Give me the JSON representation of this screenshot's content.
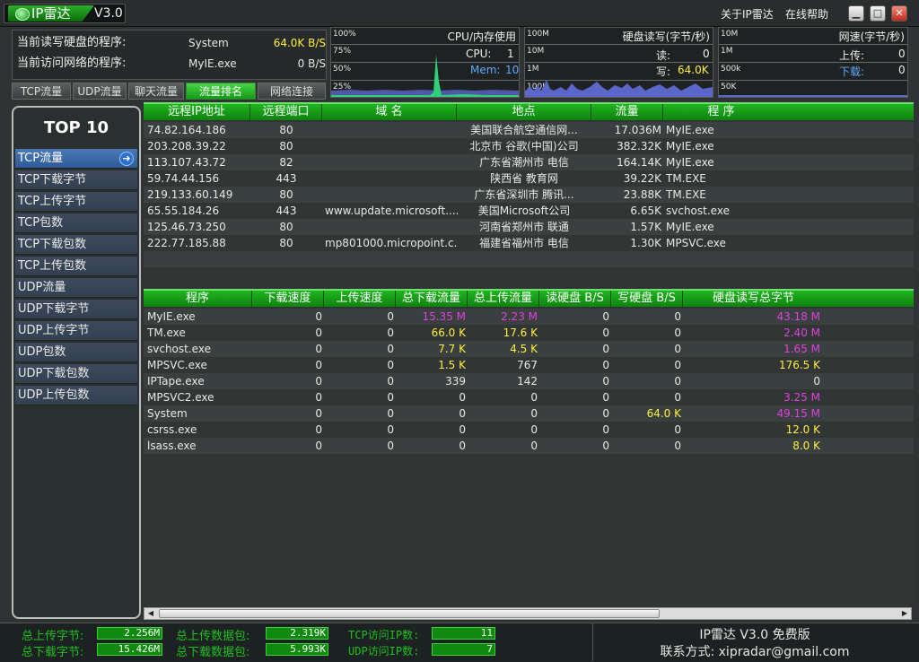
{
  "title": {
    "app_name": "IP雷达",
    "version": "V3.0",
    "menu_about": "关于IP雷达",
    "menu_help": "在线帮助"
  },
  "info": {
    "disk_label": "当前读写硬盘的程序:",
    "disk_process": "System",
    "disk_value": "64.0K B/S",
    "net_label": "当前访问网络的程序:",
    "net_process": "MyIE.exe",
    "net_value": "0 B/S"
  },
  "tabs": [
    "TCP流量",
    "UDP流量",
    "聊天流量",
    "流量排名",
    "网络连接"
  ],
  "active_tab_index": 3,
  "graphs": {
    "cpu": {
      "title": "CPU/内存使用",
      "ticks": [
        "100%",
        "75%",
        "50%",
        "25%"
      ],
      "cpu_label": "CPU:",
      "cpu_value": "1",
      "mem_label": "Mem:",
      "mem_value": "10"
    },
    "disk": {
      "title": "硬盘读写(字节/秒)",
      "ticks": [
        "100M",
        "10M",
        "1M",
        "100K"
      ],
      "read_label": "读:",
      "read_value": "0",
      "write_label": "写:",
      "write_value": "64.0K"
    },
    "net": {
      "title": "网速(字节/秒)",
      "ticks": [
        "10M",
        "1M",
        "500k",
        "50K"
      ],
      "up_label": "上传:",
      "up_value": "0",
      "down_label": "下载:",
      "down_value": "0"
    }
  },
  "left_panel": {
    "title": "TOP 10",
    "active_index": 0,
    "items": [
      "TCP流量",
      "TCP下载字节",
      "TCP上传字节",
      "TCP包数",
      "TCP下载包数",
      "TCP上传包数",
      "UDP流量",
      "UDP下载字节",
      "UDP上传字节",
      "UDP包数",
      "UDP下载包数",
      "UDP上传包数"
    ]
  },
  "connections": {
    "headers": [
      "远程IP地址",
      "远程端口",
      "域  名",
      "地点",
      "流量",
      "程  序"
    ],
    "rows": [
      [
        "74.82.164.186",
        "80",
        "",
        "美国联合航空通信网...",
        "17.036M",
        "MyIE.exe"
      ],
      [
        "203.208.39.22",
        "80",
        "",
        "北京市 谷歌(中国)公司",
        "382.32K",
        "MyIE.exe"
      ],
      [
        "113.107.43.72",
        "82",
        "",
        "广东省潮州市 电信",
        "164.14K",
        "MyIE.exe"
      ],
      [
        "59.74.44.156",
        "443",
        "",
        "陕西省 教育网",
        "39.22K",
        "TM.EXE"
      ],
      [
        "219.133.60.149",
        "80",
        "",
        "广东省深圳市 腾讯...",
        "23.88K",
        "TM.EXE"
      ],
      [
        "65.55.184.26",
        "443",
        "www.update.microsoft....",
        "美国Microsoft公司",
        "6.65K",
        "svchost.exe"
      ],
      [
        "125.46.73.250",
        "80",
        "",
        "河南省郑州市 联通",
        "1.57K",
        "MyIE.exe"
      ],
      [
        "222.77.185.88",
        "80",
        "mp801000.micropoint.c...",
        "福建省福州市 电信",
        "1.30K",
        "MPSVC.exe"
      ]
    ]
  },
  "processes": {
    "headers": [
      "程序",
      "下载速度",
      "上传速度",
      "总下载流量",
      "总上传流量",
      "读硬盘 B/S",
      "写硬盘 B/S",
      "硬盘读写总字节"
    ],
    "rows": [
      [
        "MyIE.exe",
        "0",
        "0",
        "15.35 M",
        "2.23 M",
        "0",
        "0",
        "43.18 M"
      ],
      [
        "TM.exe",
        "0",
        "0",
        "66.0 K",
        "17.6 K",
        "0",
        "0",
        "2.40 M"
      ],
      [
        "svchost.exe",
        "0",
        "0",
        "7.7 K",
        "4.5 K",
        "0",
        "0",
        "1.65 M"
      ],
      [
        "MPSVC.exe",
        "0",
        "0",
        "1.5 K",
        "767",
        "0",
        "0",
        "176.5 K"
      ],
      [
        "IPTape.exe",
        "0",
        "0",
        "339",
        "142",
        "0",
        "0",
        "0"
      ],
      [
        "MPSVC2.exe",
        "0",
        "0",
        "0",
        "0",
        "0",
        "0",
        "3.25 M"
      ],
      [
        "System",
        "0",
        "0",
        "0",
        "0",
        "0",
        "64.0 K",
        "49.15 M"
      ],
      [
        "csrss.exe",
        "0",
        "0",
        "0",
        "0",
        "0",
        "0",
        "12.0 K"
      ],
      [
        "lsass.exe",
        "0",
        "0",
        "0",
        "0",
        "0",
        "0",
        "8.0 K"
      ]
    ]
  },
  "status": {
    "upload_bytes_label": "总上传字节:",
    "upload_bytes": "2.256M",
    "download_bytes_label": "总下载字节:",
    "download_bytes": "15.426M",
    "upload_packets_label": "总上传数据包:",
    "upload_packets": "2.319K",
    "download_packets_label": "总下载数据包:",
    "download_packets": "5.993K",
    "tcp_ip_label": "TCP访问IP数:",
    "tcp_ip": "11",
    "udp_ip_label": "UDP访问IP数:",
    "udp_ip": "7",
    "product": "IP雷达 V3.0 免费版",
    "contact": "联系方式: xipradar@gmail.com"
  },
  "colors": {
    "magenta": "#e040e0",
    "yellow": "#ffee40",
    "header_green": "#1fb51f",
    "cpu_graph": "#2fd07a",
    "disk_graph": "#5a66c8"
  }
}
